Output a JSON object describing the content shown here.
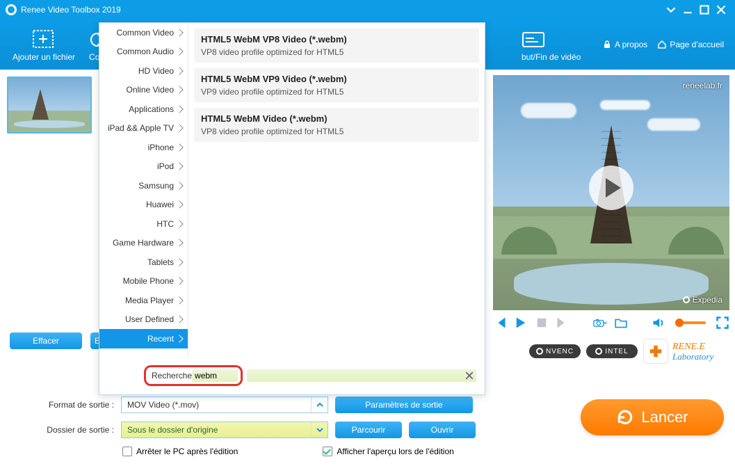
{
  "titlebar": {
    "title": "Renee Video Toolbox 2019"
  },
  "toolbar": {
    "add_file": "Ajouter un fichier",
    "item2_prefix": "Co",
    "item_end_suffix": "but/Fin de vidéo",
    "about": "A propos",
    "home": "Page d'accueil"
  },
  "format_popup": {
    "categories": [
      "Common Video",
      "Common Audio",
      "HD Video",
      "Online Video",
      "Applications",
      "iPad && Apple TV",
      "iPhone",
      "iPod",
      "Samsung",
      "Huawei",
      "HTC",
      "Game Hardware",
      "Tablets",
      "Mobile Phone",
      "Media Player",
      "User Defined",
      "Recent"
    ],
    "active_category_index": 16,
    "results": [
      {
        "title": "HTML5 WebM VP8 Video (*.webm)",
        "subtitle": "VP8 video profile optimized for HTML5"
      },
      {
        "title": "HTML5 WebM VP9 Video (*.webm)",
        "subtitle": "VP9 video profile optimized for HTML5"
      },
      {
        "title": "HTML5 WebM Video (*.webm)",
        "subtitle": "VP8 video profile optimized for HTML5"
      }
    ],
    "search_label": "Recherche",
    "search_value": "webm"
  },
  "player": {
    "watermark": "reneelab.fr",
    "expedia": "Expedia"
  },
  "hw": {
    "nvenc": "NVENC",
    "intel": "INTEL"
  },
  "renee_logo": {
    "line1": "RENE.E",
    "line2": "Laboratory"
  },
  "buttons": {
    "clear": "Effacer",
    "e_prefix": "E"
  },
  "form": {
    "format_label": "Format de sortie :",
    "format_value": "MOV Video (*.mov)",
    "params": "Paramètres de sortie",
    "folder_label": "Dossier de sortie :",
    "folder_value": "Sous le dossier d'origine",
    "browse": "Parcourir",
    "open": "Ouvrir",
    "shutdown": "Arrêter le PC après l'édition",
    "preview": "Afficher l'aperçu lors de l'édition"
  },
  "launch": "Lancer"
}
